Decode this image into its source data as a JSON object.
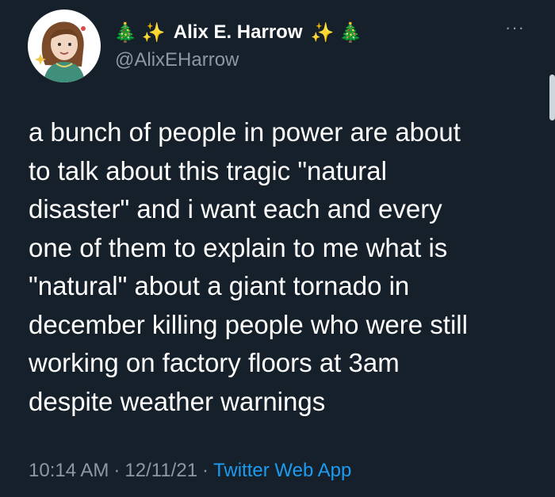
{
  "author": {
    "name": "Alix E. Harrow",
    "handle": "@AlixEHarrow",
    "name_decor_left": [
      "🎄",
      "✨"
    ],
    "name_decor_right": [
      "✨",
      "🎄"
    ],
    "avatar_icon": "illustrated-portrait"
  },
  "menu": {
    "more_label": "···"
  },
  "tweet": {
    "text": "a bunch of people in power are about\nto talk about this tragic \"natural\ndisaster\" and i want each and every\none of them to explain to me what is\n\"natural\" about a giant tornado in\ndecember killing people who were still\nworking on factory floors at 3am\ndespite weather warnings"
  },
  "meta": {
    "time": "10:14 AM",
    "separator": "·",
    "date": "12/11/21",
    "source": "Twitter Web App"
  },
  "colors": {
    "background": "#15202b",
    "text": "#ffffff",
    "secondary": "#8b98a5",
    "link": "#1d9bf0"
  }
}
